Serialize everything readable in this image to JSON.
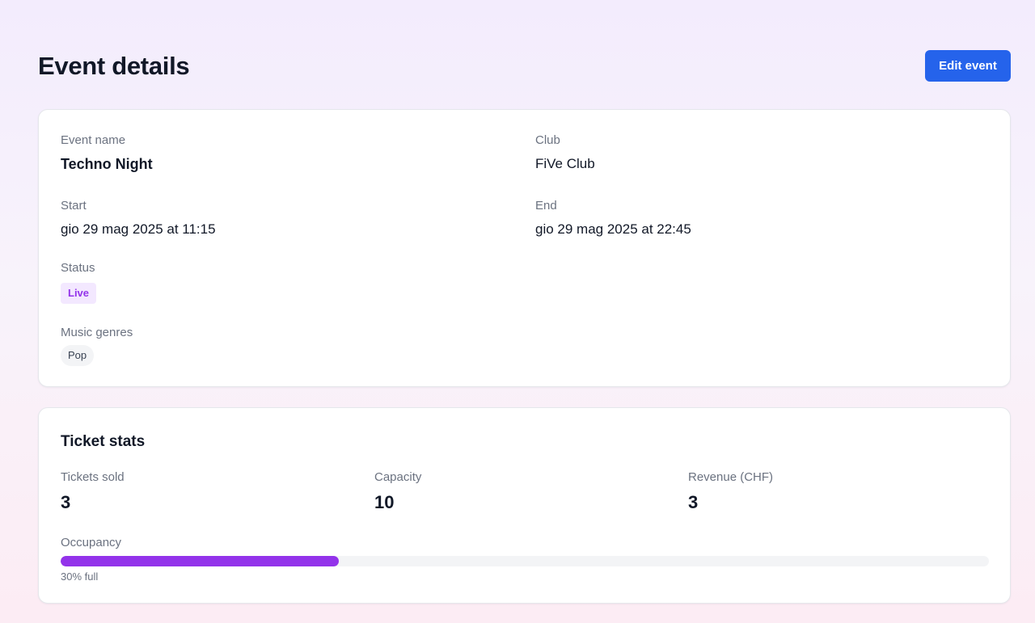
{
  "header": {
    "title": "Event details",
    "edit_label": "Edit event"
  },
  "details": {
    "event_name_label": "Event name",
    "event_name": "Techno Night",
    "club_label": "Club",
    "club": "FiVe Club",
    "start_label": "Start",
    "start": "gio 29 mag 2025 at 11:15",
    "end_label": "End",
    "end": "gio 29 mag 2025 at 22:45",
    "status_label": "Status",
    "status": "Live",
    "genres_label": "Music genres",
    "genres": [
      "Pop"
    ]
  },
  "stats": {
    "title": "Ticket stats",
    "sold_label": "Tickets sold",
    "sold": "3",
    "capacity_label": "Capacity",
    "capacity": "10",
    "revenue_label": "Revenue (CHF)",
    "revenue": "3",
    "occupancy_label": "Occupancy",
    "occupancy_percent": 30,
    "occupancy_text": "30% full"
  },
  "colors": {
    "accent": "#2563eb",
    "live_badge_bg": "#f3e8ff",
    "live_badge_text": "#9333ea",
    "progress": "#9333ea"
  }
}
